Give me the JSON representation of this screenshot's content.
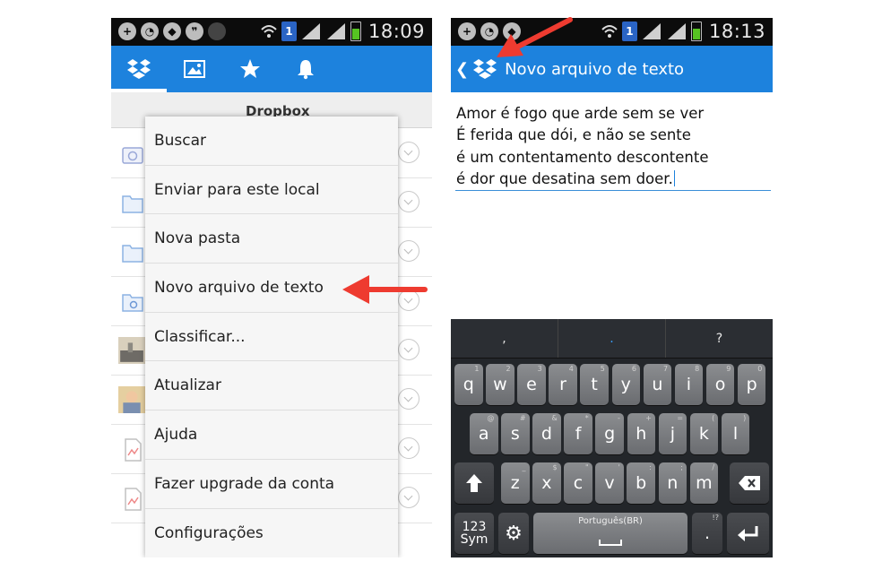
{
  "left_phone": {
    "status_time": "18:09",
    "sim_slot": "1",
    "tabs": [
      {
        "name": "dropbox-tab-icon",
        "active": true
      },
      {
        "name": "photos-tab-icon",
        "active": false
      },
      {
        "name": "favorites-tab-icon",
        "active": false
      },
      {
        "name": "notifications-tab-icon",
        "active": false
      }
    ],
    "breadcrumb_title": "Dropbox",
    "menu_items": [
      "Buscar",
      "Enviar para este local",
      "Nova pasta",
      "Novo arquivo de texto",
      "Classificar...",
      "Atualizar",
      "Ajuda",
      "Fazer upgrade da conta",
      "Configurações"
    ],
    "highlighted_item": "Novo arquivo de texto"
  },
  "right_phone": {
    "status_time": "18:13",
    "sim_slot": "1",
    "title": "Novo arquivo de texto",
    "editor_lines": [
      "Amor é fogo que arde sem se ver",
      "É ferida que dói, e não se sente",
      "é um contentamento descontente",
      "é dor que desatina sem doer."
    ],
    "suggestions": [
      ",",
      ".",
      "?"
    ],
    "keyboard": {
      "row1": [
        [
          "q",
          "1"
        ],
        [
          "w",
          "2"
        ],
        [
          "e",
          "3"
        ],
        [
          "r",
          "4"
        ],
        [
          "t",
          "5"
        ],
        [
          "y",
          "6"
        ],
        [
          "u",
          "7"
        ],
        [
          "i",
          "8"
        ],
        [
          "o",
          "9"
        ],
        [
          "p",
          "0"
        ]
      ],
      "row2": [
        [
          "a",
          "@"
        ],
        [
          "s",
          "#"
        ],
        [
          "d",
          "&"
        ],
        [
          "f",
          "*"
        ],
        [
          "g",
          "-"
        ],
        [
          "h",
          "+"
        ],
        [
          "j",
          "="
        ],
        [
          "k",
          "("
        ],
        [
          "l",
          ")"
        ]
      ],
      "row3": [
        [
          "z",
          "_"
        ],
        [
          "x",
          "$"
        ],
        [
          "c",
          "\""
        ],
        [
          "v",
          "'"
        ],
        [
          "b",
          ":"
        ],
        [
          "n",
          ";"
        ],
        [
          "m",
          "/"
        ]
      ],
      "sym_top": "123",
      "sym_bottom": "Sym",
      "space_label": "Português(BR)",
      "period_key": ".",
      "period_hint": "!?"
    }
  },
  "colors": {
    "action_bar": "#1d82dd",
    "arrow": "#ee3b30"
  }
}
